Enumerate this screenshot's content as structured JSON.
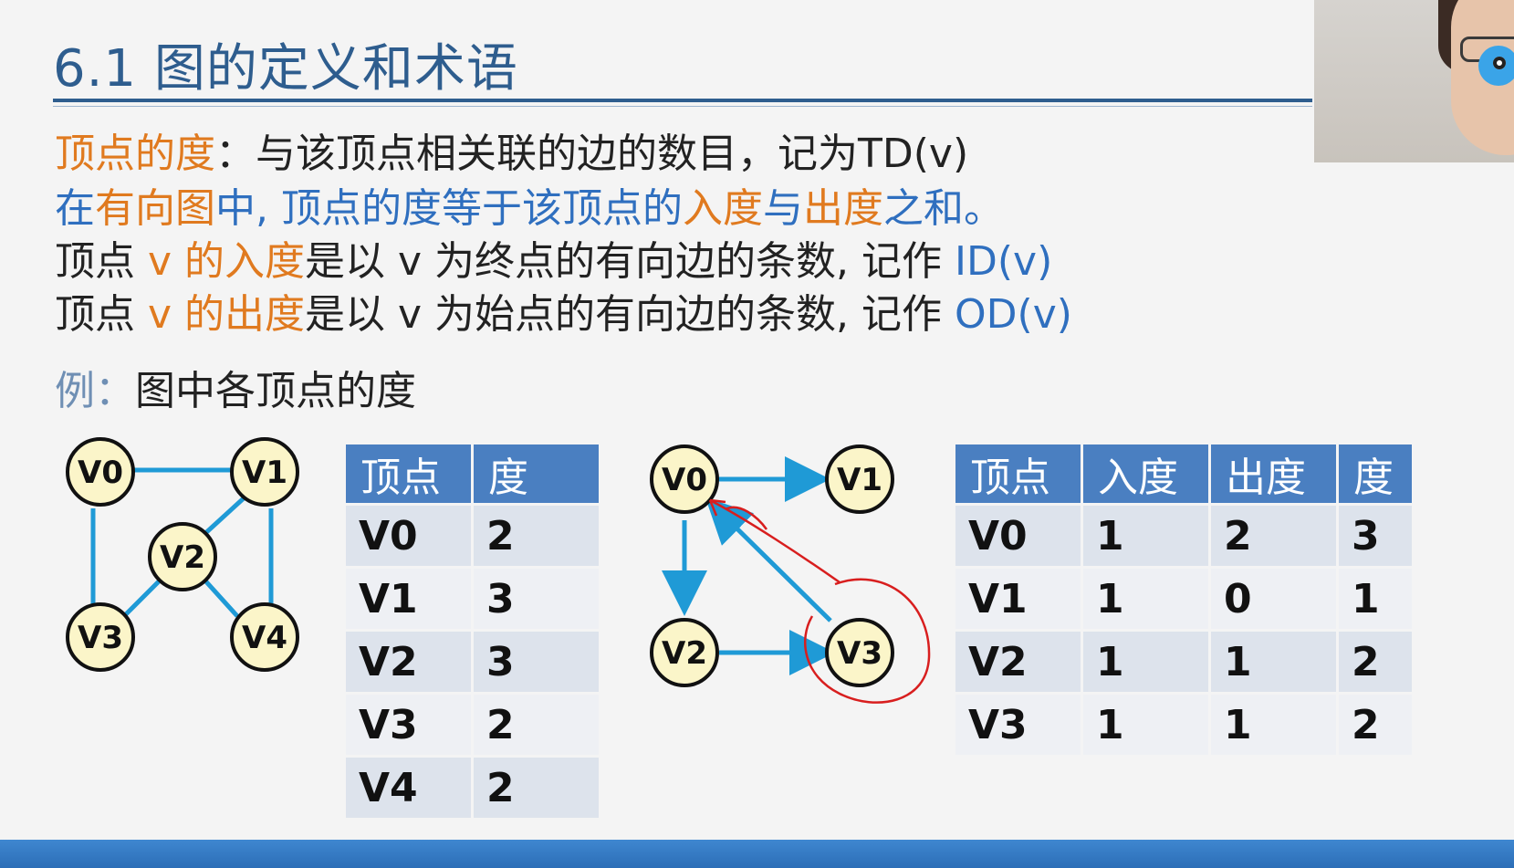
{
  "title": "6.1 图的定义和术语",
  "lines": {
    "l1_term": "顶点的度",
    "l1_rest": "：与该顶点相关联的边的数目，记为TD(v)",
    "l2_a": "在",
    "l2_b": "有向图",
    "l2_c": "中, 顶点的度等于该顶点的",
    "l2_d": "入度",
    "l2_e": "与",
    "l2_f": "出度",
    "l2_g": "之和。",
    "l3_a": "顶点 ",
    "l3_b": "v 的入度",
    "l3_c": "是以 v 为终点的有向边的条数, 记作 ",
    "l3_d": "ID(v)",
    "l4_a": "顶点 ",
    "l4_b": "v 的出度",
    "l4_c": "是以 v 为始点的有向边的条数, 记作 ",
    "l4_d": "OD(v)"
  },
  "example": {
    "label": "例：",
    "text": "图中各顶点的度"
  },
  "undirected": {
    "nodes": [
      "V0",
      "V1",
      "V2",
      "V3",
      "V4"
    ]
  },
  "directed": {
    "nodes": [
      "V0",
      "V1",
      "V2",
      "V3"
    ]
  },
  "table1": {
    "headers": [
      "顶点",
      "度"
    ],
    "rows": [
      [
        "V0",
        "2"
      ],
      [
        "V1",
        "3"
      ],
      [
        "V2",
        "3"
      ],
      [
        "V3",
        "2"
      ],
      [
        "V4",
        "2"
      ]
    ]
  },
  "table2": {
    "headers": [
      "顶点",
      "入度",
      "出度",
      "度"
    ],
    "rows": [
      [
        "V0",
        "1",
        "2",
        "3"
      ],
      [
        "V1",
        "1",
        "0",
        "1"
      ],
      [
        "V2",
        "1",
        "1",
        "2"
      ],
      [
        "V3",
        "1",
        "1",
        "2"
      ]
    ]
  },
  "colors": {
    "accent_orange": "#e07a1f",
    "accent_blue": "#2f6fbf",
    "node_fill": "#fbf5c9",
    "edge": "#1f9ad6",
    "annotation_red": "#d81e1e"
  }
}
